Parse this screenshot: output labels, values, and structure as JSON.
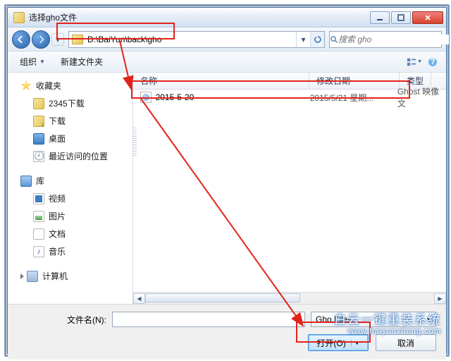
{
  "window": {
    "title": "选择gho文件"
  },
  "nav": {
    "path": "D:\\BaiYun\\back\\gho",
    "search_placeholder": "搜索 gho"
  },
  "toolbar": {
    "organize": "组织",
    "newfolder": "新建文件夹"
  },
  "sidebar": {
    "favorites": "收藏夹",
    "fav_items": [
      "2345下载",
      "下载",
      "桌面",
      "最近访问的位置"
    ],
    "libraries": "库",
    "lib_items": [
      "视频",
      "图片",
      "文档",
      "音乐"
    ],
    "computer": "计算机"
  },
  "columns": {
    "name": "名称",
    "date": "修改日期",
    "type": "类型"
  },
  "files": [
    {
      "name": "2015-5-20",
      "date": "2015/5/21 星期...",
      "type": "Ghost 映像文"
    }
  ],
  "footer": {
    "filename_label": "文件名(N):",
    "filename_value": "",
    "filter": "Gho Files",
    "open": "打开(O)",
    "cancel": "取消"
  },
  "watermark": {
    "line1": "白云一键重装系统",
    "line2": "www.baiyunxitong.com"
  }
}
